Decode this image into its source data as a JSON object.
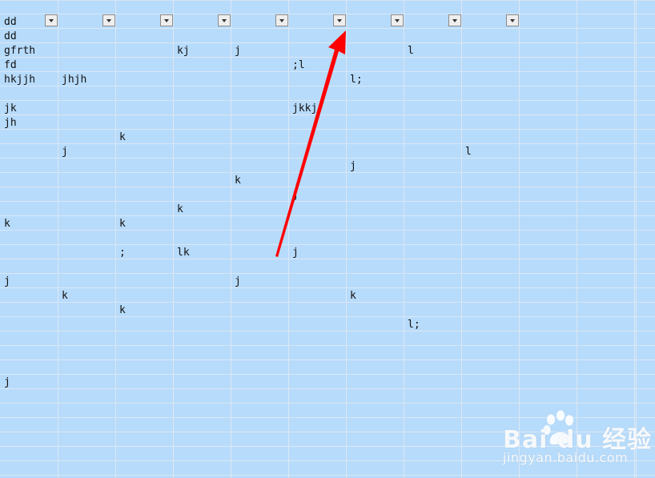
{
  "sheet": {
    "columns": 11,
    "filter_columns": [
      0,
      1,
      2,
      3,
      4,
      5,
      6,
      7,
      8
    ],
    "cells": [
      {
        "row": 0,
        "col": 0,
        "text": "dd"
      },
      {
        "row": 1,
        "col": 0,
        "text": "dd"
      },
      {
        "row": 2,
        "col": 0,
        "text": "gfrth"
      },
      {
        "row": 2,
        "col": 3,
        "text": "kj"
      },
      {
        "row": 2,
        "col": 4,
        "text": "j"
      },
      {
        "row": 2,
        "col": 7,
        "text": "l"
      },
      {
        "row": 3,
        "col": 0,
        "text": "fd"
      },
      {
        "row": 3,
        "col": 5,
        "text": ";l"
      },
      {
        "row": 4,
        "col": 0,
        "text": "hkjjh"
      },
      {
        "row": 4,
        "col": 1,
        "text": "jhjh"
      },
      {
        "row": 4,
        "col": 6,
        "text": "l;"
      },
      {
        "row": 6,
        "col": 0,
        "text": "jk"
      },
      {
        "row": 6,
        "col": 5,
        "text": "jkkj"
      },
      {
        "row": 7,
        "col": 0,
        "text": "jh"
      },
      {
        "row": 8,
        "col": 2,
        "text": "k"
      },
      {
        "row": 9,
        "col": 1,
        "text": "j"
      },
      {
        "row": 9,
        "col": 8,
        "text": "l"
      },
      {
        "row": 10,
        "col": 6,
        "text": "j"
      },
      {
        "row": 11,
        "col": 4,
        "text": "k"
      },
      {
        "row": 12,
        "col": 5,
        "text": "j"
      },
      {
        "row": 13,
        "col": 3,
        "text": "k"
      },
      {
        "row": 14,
        "col": 0,
        "text": "k"
      },
      {
        "row": 14,
        "col": 2,
        "text": "k"
      },
      {
        "row": 16,
        "col": 2,
        "text": ";"
      },
      {
        "row": 16,
        "col": 3,
        "text": "lk"
      },
      {
        "row": 16,
        "col": 5,
        "text": "j"
      },
      {
        "row": 18,
        "col": 0,
        "text": "j"
      },
      {
        "row": 18,
        "col": 4,
        "text": "j"
      },
      {
        "row": 19,
        "col": 1,
        "text": "k"
      },
      {
        "row": 19,
        "col": 6,
        "text": "k"
      },
      {
        "row": 20,
        "col": 2,
        "text": "k"
      },
      {
        "row": 21,
        "col": 7,
        "text": "l;"
      },
      {
        "row": 25,
        "col": 0,
        "text": "j"
      }
    ]
  },
  "annotation": {
    "arrow_color": "#ff0000",
    "points_to": "filter-dropdown-6"
  },
  "watermark": {
    "brand": "Bai du 经验",
    "url": "jingyan.baidu.com",
    "icon": "paw-icon"
  }
}
